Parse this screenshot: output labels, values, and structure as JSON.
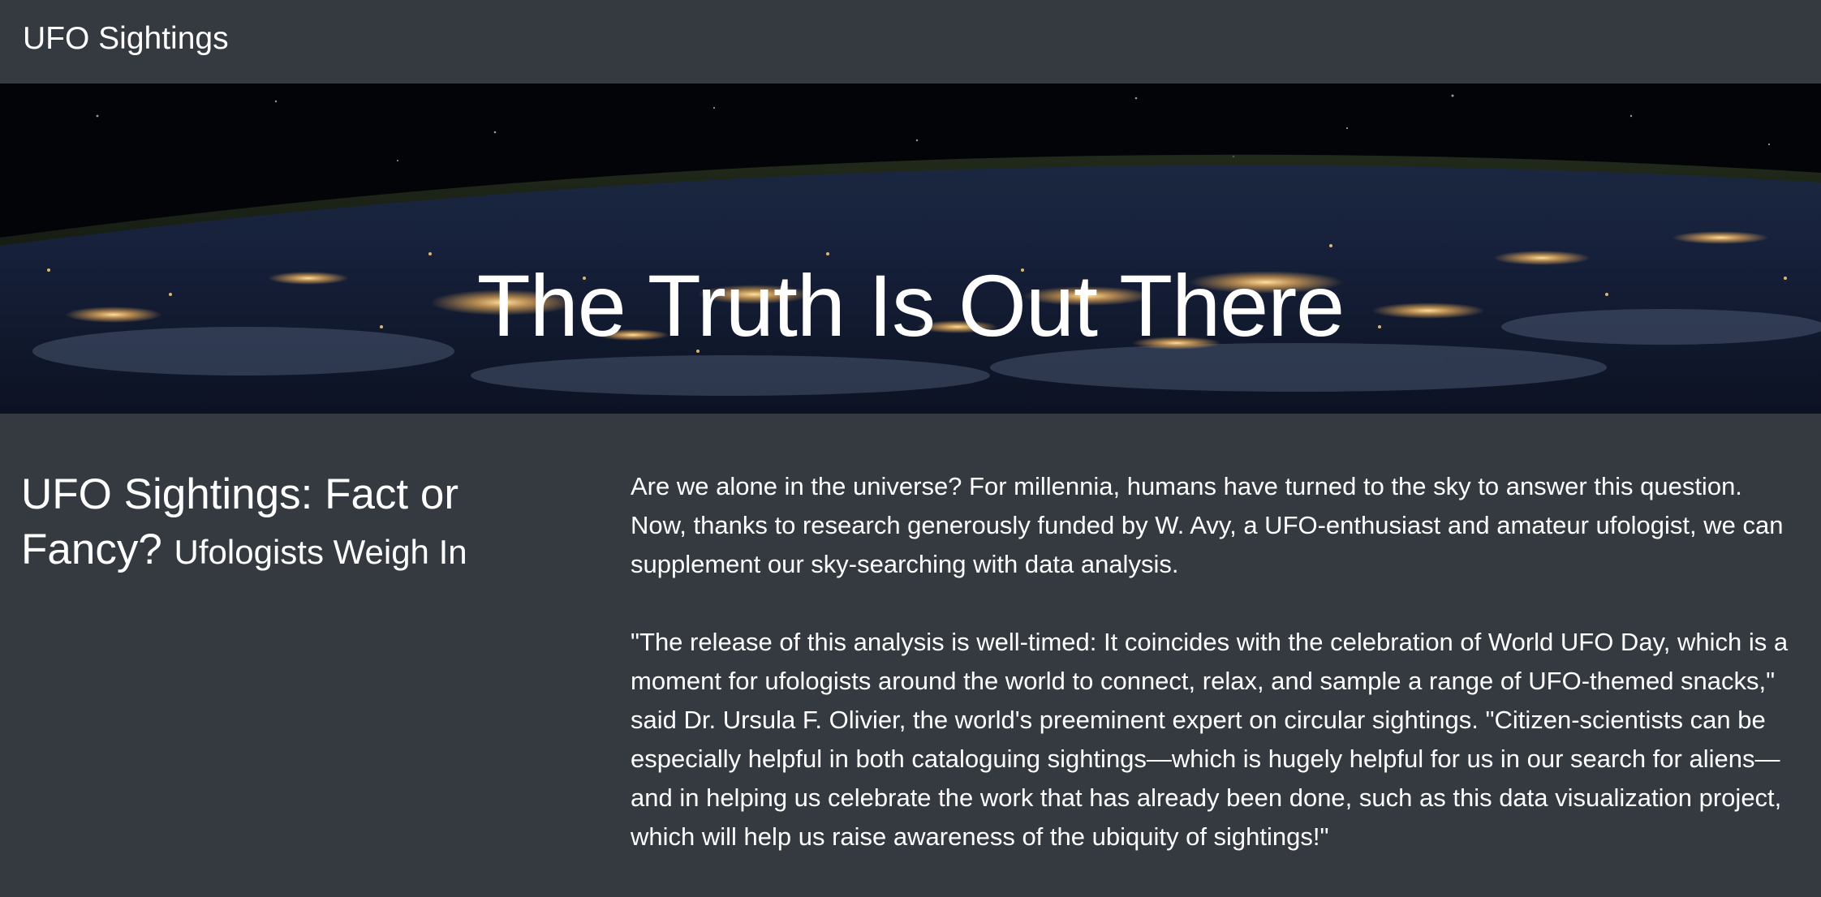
{
  "navbar": {
    "brand": "UFO Sightings"
  },
  "hero": {
    "title": "The Truth Is Out There"
  },
  "article": {
    "heading": "UFO Sightings: Fact or Fancy?",
    "subheading": "Ufologists Weigh In",
    "paragraphs": [
      "Are we alone in the universe? For millennia, humans have turned to the sky to answer this question. Now, thanks to research generously funded by W. Avy, a UFO-enthusiast and amateur ufologist, we can supplement our sky-searching with data analysis.",
      "\"The release of this analysis is well-timed: It coincides with the celebration of World UFO Day, which is a moment for ufologists around the world to connect, relax, and sample a range of UFO-themed snacks,\" said Dr. Ursula F. Olivier, the world's preeminent expert on circular sightings. \"Citizen-scientists can be especially helpful in both cataloguing sightings—which is hugely helpful for us in our search for aliens—and in helping us celebrate the work that has already been done, such as this data visualization project, which will help us raise awareness of the ubiquity of sightings!\""
    ]
  },
  "colors": {
    "background": "#343a40",
    "text": "#ffffff",
    "city_lights": "#ffd27a"
  }
}
